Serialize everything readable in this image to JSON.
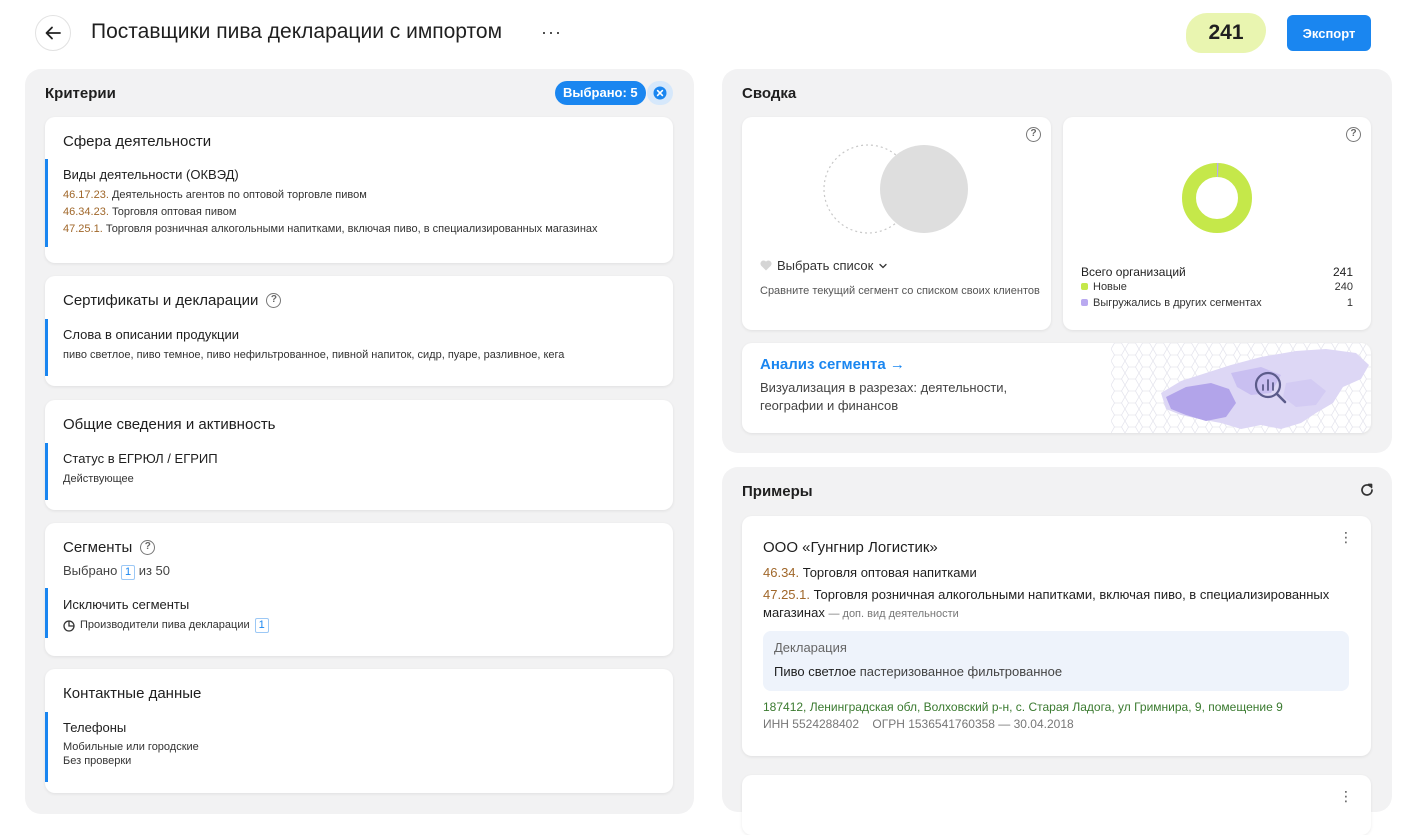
{
  "header": {
    "title": "Поставщики пива декларации с импортом",
    "more": "···",
    "count": "241",
    "export_label": "Экспорт"
  },
  "criteria": {
    "title": "Критерии",
    "selected_label": "Выбрано: 5",
    "cards": {
      "activity": {
        "title": "Сфера деятельности",
        "crit_title": "Виды деятельности (ОКВЭД)",
        "items": [
          {
            "code": "46.17.23.",
            "text": "Деятельность агентов по оптовой торговле пивом"
          },
          {
            "code": "46.34.23.",
            "text": "Торговля оптовая пивом"
          },
          {
            "code": "47.25.1.",
            "text": "Торговля розничная алкогольными напитками, включая пиво, в специализированных магазинах"
          }
        ]
      },
      "certs": {
        "title": "Сертификаты и декларации",
        "crit_title": "Слова в описании продукции",
        "value": "пиво светлое, пиво темное, пиво нефильтрованное, пивной напиток, сидр, пуаре, разливное, кега"
      },
      "general": {
        "title": "Общие сведения и активность",
        "crit_title": "Статус в ЕГРЮЛ / ЕГРИП",
        "value": "Действующее"
      },
      "segments": {
        "title": "Сегменты",
        "selected_prefix": "Выбрано",
        "selected_count": "1",
        "selected_suffix": "из 50",
        "crit_title": "Исключить сегменты",
        "segment_name": "Производители пива декларации",
        "segment_count": "1"
      },
      "contacts": {
        "title": "Контактные данные",
        "crit_title": "Телефоны",
        "line1": "Мобильные или городские",
        "line2": "Без проверки"
      }
    }
  },
  "summary": {
    "title": "Сводка",
    "compare": {
      "select_label": "Выбрать список",
      "hint": "Сравните текущий сегмент со списком своих клиентов"
    },
    "totals": {
      "total_label": "Всего организаций",
      "total_value": "241",
      "new_label": "Новые",
      "new_value": "240",
      "exported_label": "Выгружались в других сегментах",
      "exported_value": "1",
      "new_color": "#c5e84a",
      "exported_color": "#b9a9f0"
    },
    "analysis": {
      "title": "Анализ сегмента →",
      "desc": "Визуализация в разрезах: деятельности, географии и финансов"
    }
  },
  "examples": {
    "title": "Примеры",
    "items": [
      {
        "name": "ООО «Гунгнир Логистик»",
        "line1_code": "46.34.",
        "line1_text": "Торговля оптовая напитками",
        "line2_code": "47.25.1.",
        "line2_text": "Торговля розничная алкогольными напитками, включая пиво, в специализированных магазинах",
        "line2_extra": "— доп. вид деятельности",
        "decl_label": "Декларация",
        "decl_bold": "Пиво светлое",
        "decl_rest": "пастеризованное фильтрованное",
        "address": "187412, Ленинградская обл, Волховский р-н, с. Старая Ладога, ул Гримнира, 9, помещение 9",
        "ids": "ИНН 5524288402    ОГРН 1536541760358 — 30.04.2018"
      }
    ]
  },
  "colors": {
    "accent": "#1a86f0",
    "count_bg": "#e9f5b0",
    "okved_code": "#a0672a",
    "address": "#3a7a2f"
  }
}
